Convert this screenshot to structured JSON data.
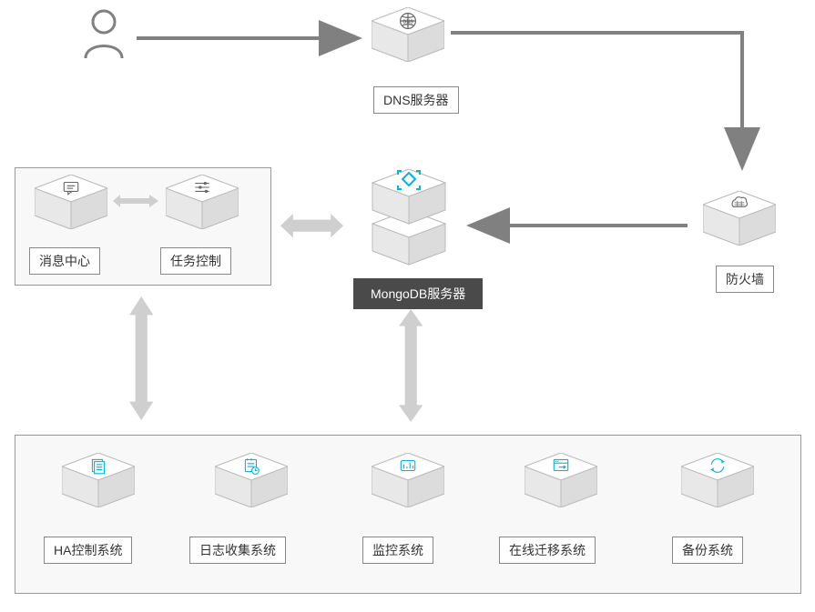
{
  "nodes": {
    "user": "用户",
    "dns": "DNS服务器",
    "message_center": "消息中心",
    "task_control": "任务控制",
    "mongodb_server": "MongoDB服务器",
    "firewall": "防火墙",
    "ha_control": "HA控制系统",
    "log_collect": "日志收集系统",
    "monitor": "监控系统",
    "online_migrate": "在线迁移系统",
    "backup": "备份系统"
  },
  "icons": {
    "user": "user-icon",
    "dns": "dns-globe-icon",
    "message": "chat-icon",
    "task": "sliders-icon",
    "mongodb": "arrows-icon",
    "firewall": "firewall-icon",
    "ha": "document-icon",
    "log": "calendar-clock-icon",
    "monitor": "chart-icon",
    "migrate": "window-arrow-icon",
    "backup": "sync-icon"
  },
  "colors": {
    "line_gray": "#808080",
    "light_gray": "#cfcfcf",
    "cube_face": "#f5f5f5",
    "cube_top": "#ffffff",
    "cube_shadow": "#dcdcdc",
    "accent": "#00b4e6",
    "dark": "#4a4a4a"
  },
  "layout_hint": "User → DNS → Firewall → MongoDB; Message/Task ↔ MongoDB; MongoDB & Message/Task ↕ backend systems (HA, Log, Monitor, Migrate, Backup)"
}
